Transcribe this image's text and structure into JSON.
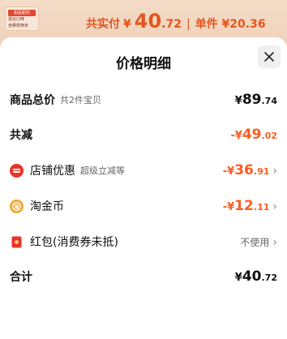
{
  "background": {
    "thumb_tag": "甜品甜饮",
    "thumb_line1": "混合口味",
    "thumb_line2": "含椰浆西米"
  },
  "summary": {
    "actual_label": "共实付",
    "currency": "¥",
    "actual_integer": "40",
    "actual_decimal": ".72",
    "separator": "|",
    "unit_price": "单件 ¥20.36"
  },
  "sheet": {
    "title": "价格明细",
    "close_label": "×"
  },
  "rows": {
    "total": {
      "label": "商品总价",
      "sub": "共2件宝贝",
      "currency": "¥",
      "integer": "89",
      "decimal": ".74"
    },
    "reduce": {
      "label": "共减",
      "currency": "-¥",
      "integer": "49",
      "decimal": ".02"
    },
    "shop": {
      "label": "店铺优惠",
      "sub": "超级立减等",
      "currency": "-¥",
      "integer": "36",
      "decimal": ".91",
      "chevron": "›"
    },
    "coin": {
      "label": "淘金币",
      "currency": "-¥",
      "integer": "12",
      "decimal": ".11",
      "chevron": "›"
    },
    "redpack": {
      "label": "红包(消费券未抵)",
      "value": "不使用",
      "chevron": "›"
    },
    "sum": {
      "label": "合计",
      "currency": "¥",
      "integer": "40",
      "decimal": ".72"
    }
  },
  "colors": {
    "accent": "#ff5a1f",
    "shop_icon": "#e8332a",
    "coin_icon": "#f5a623",
    "redpack_icon": "#e8332a"
  }
}
